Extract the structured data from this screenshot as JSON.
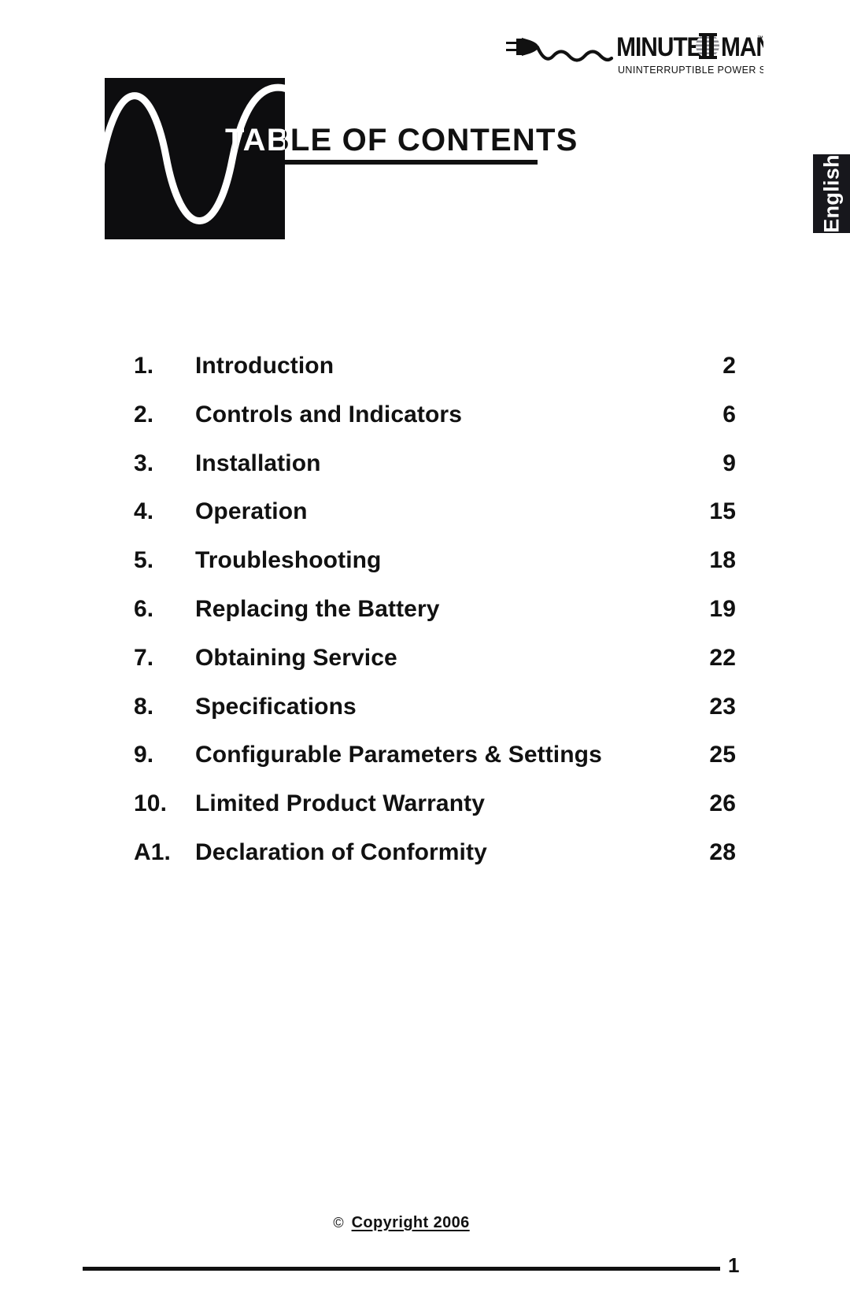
{
  "document": {
    "page_title": "TABLE OF CONTENTS",
    "page_number": "1",
    "language_tab": "English"
  },
  "brand": {
    "name": "MINUTEMAN",
    "name_part_1": "MINUTE",
    "name_part_2": "MAN",
    "tagline": "UNINTERRUPTIBLE POWER SUPPLIES",
    "trademark": "™"
  },
  "toc": {
    "entries": [
      {
        "number": "1.",
        "title": "Introduction",
        "page": "2"
      },
      {
        "number": "2.",
        "title": "Controls and Indicators",
        "page": "6"
      },
      {
        "number": "3.",
        "title": "Installation",
        "page": "9"
      },
      {
        "number": "4.",
        "title": "Operation",
        "page": "15"
      },
      {
        "number": "5.",
        "title": "Troubleshooting",
        "page": "18"
      },
      {
        "number": "6.",
        "title": "Replacing the Battery",
        "page": "19"
      },
      {
        "number": "7.",
        "title": "Obtaining Service",
        "page": "22"
      },
      {
        "number": "8.",
        "title": "Specifications",
        "page": "23"
      },
      {
        "number": "9.",
        "title": "Configurable Parameters & Settings",
        "page": "25"
      },
      {
        "number": "10.",
        "title": "Limited Product Warranty",
        "page": "26"
      },
      {
        "number": "A1.",
        "title": "Declaration of Conformity",
        "page": "28"
      }
    ]
  },
  "footer": {
    "copyright_symbol": "©",
    "copyright_text": "Copyright 2006"
  },
  "colors": {
    "ink": "#111111",
    "mark_fill": "#0d0d0f",
    "tab_fill": "#17171c",
    "paper": "#ffffff"
  }
}
